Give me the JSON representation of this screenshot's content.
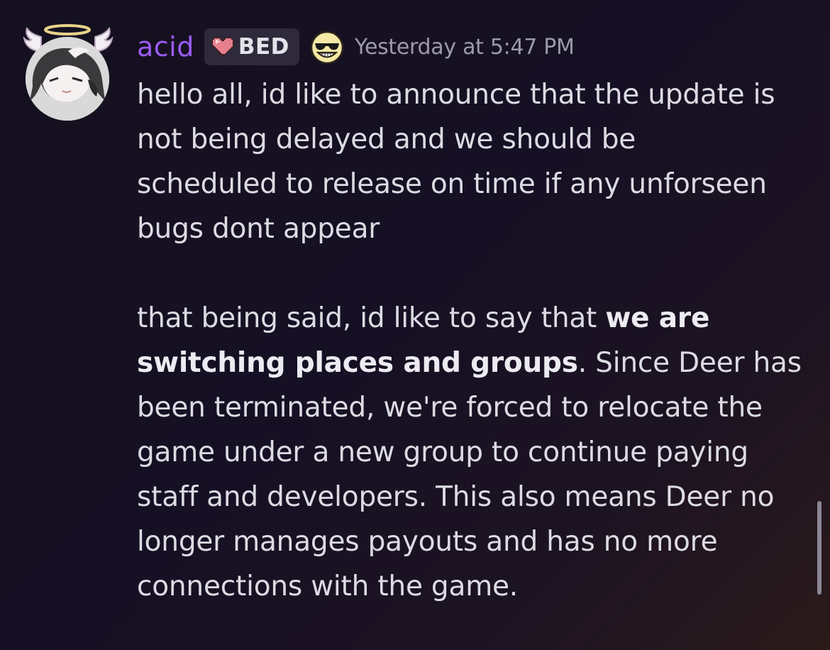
{
  "message": {
    "author": {
      "username": "acid",
      "username_color": "#9b5cf6",
      "avatar_icon": "avatar-anime-character-with-halo-and-wings"
    },
    "role_tag": {
      "icon": "pixel-heart-icon",
      "name": "BED"
    },
    "emoji": "sunglasses-grin-emoji",
    "timestamp": "Yesterday at 5:47 PM",
    "paragraph1": {
      "line1": "hello all, id like to announce that the update is",
      "line2": "not being delayed and we should be",
      "line3": "scheduled to release on time if any unforseen",
      "line4": "bugs dont appear"
    },
    "paragraph2": {
      "line1_prefix": "that being said, id like to say that ",
      "line1_bold": "we are",
      "line2_bold": "switching places and groups",
      "line2_suffix": ". Since Deer has",
      "line3": "been terminated, we're forced to relocate the",
      "line4": "game under a new group to continue paying",
      "line5": "staff and developers. This also means Deer no",
      "line6": "longer manages payouts and has no more",
      "line7": "connections with the game."
    }
  },
  "colors": {
    "text": "#dcdbe3",
    "timestamp": "#9c9aa6",
    "role_bg": "#2e2a3b"
  }
}
